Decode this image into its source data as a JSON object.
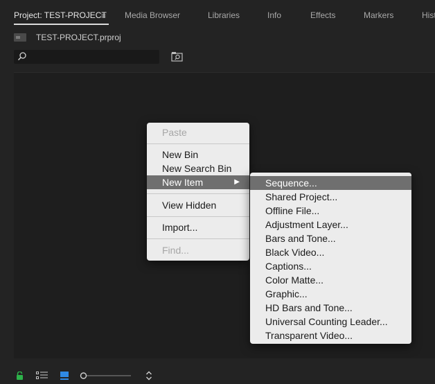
{
  "tabs": [
    {
      "label": "Project: TEST-PROJECT",
      "active": true
    },
    {
      "label": "Media Browser"
    },
    {
      "label": "Libraries"
    },
    {
      "label": "Info"
    },
    {
      "label": "Effects"
    },
    {
      "label": "Markers"
    },
    {
      "label": "Hist"
    }
  ],
  "tab_menu_icon": "≡",
  "project": {
    "file_name": "TEST-PROJECT.prproj"
  },
  "search": {
    "value": "",
    "placeholder": ""
  },
  "context_menu": {
    "items": [
      {
        "label": "Paste",
        "disabled": true
      },
      {
        "label": "New Bin"
      },
      {
        "label": "New Search Bin"
      },
      {
        "label": "New Item",
        "highlighted": true,
        "submenu_arrow": "▶"
      },
      {
        "label": "View Hidden"
      },
      {
        "label": "Import..."
      },
      {
        "label": "Find...",
        "disabled": true
      }
    ]
  },
  "submenu": {
    "items": [
      {
        "label": "Sequence...",
        "highlighted": true
      },
      {
        "label": "Shared Project..."
      },
      {
        "label": "Offline File..."
      },
      {
        "label": "Adjustment Layer..."
      },
      {
        "label": "Bars and Tone..."
      },
      {
        "label": "Black Video..."
      },
      {
        "label": "Captions..."
      },
      {
        "label": "Color Matte..."
      },
      {
        "label": "Graphic..."
      },
      {
        "label": "HD Bars and Tone..."
      },
      {
        "label": "Universal Counting Leader..."
      },
      {
        "label": "Transparent Video..."
      }
    ]
  },
  "bottom_bar": {
    "icons": [
      "lock-icon",
      "list-view-icon",
      "icon-view-icon",
      "zoom-slider",
      "sort-icon"
    ],
    "lock_color": "#2db34a",
    "icon_view_color": "#2f8ae5",
    "zoom_level": 0
  },
  "colors": {
    "background": "#232323",
    "menu_background": "#ececec",
    "menu_highlight": "#6f6f6f"
  }
}
